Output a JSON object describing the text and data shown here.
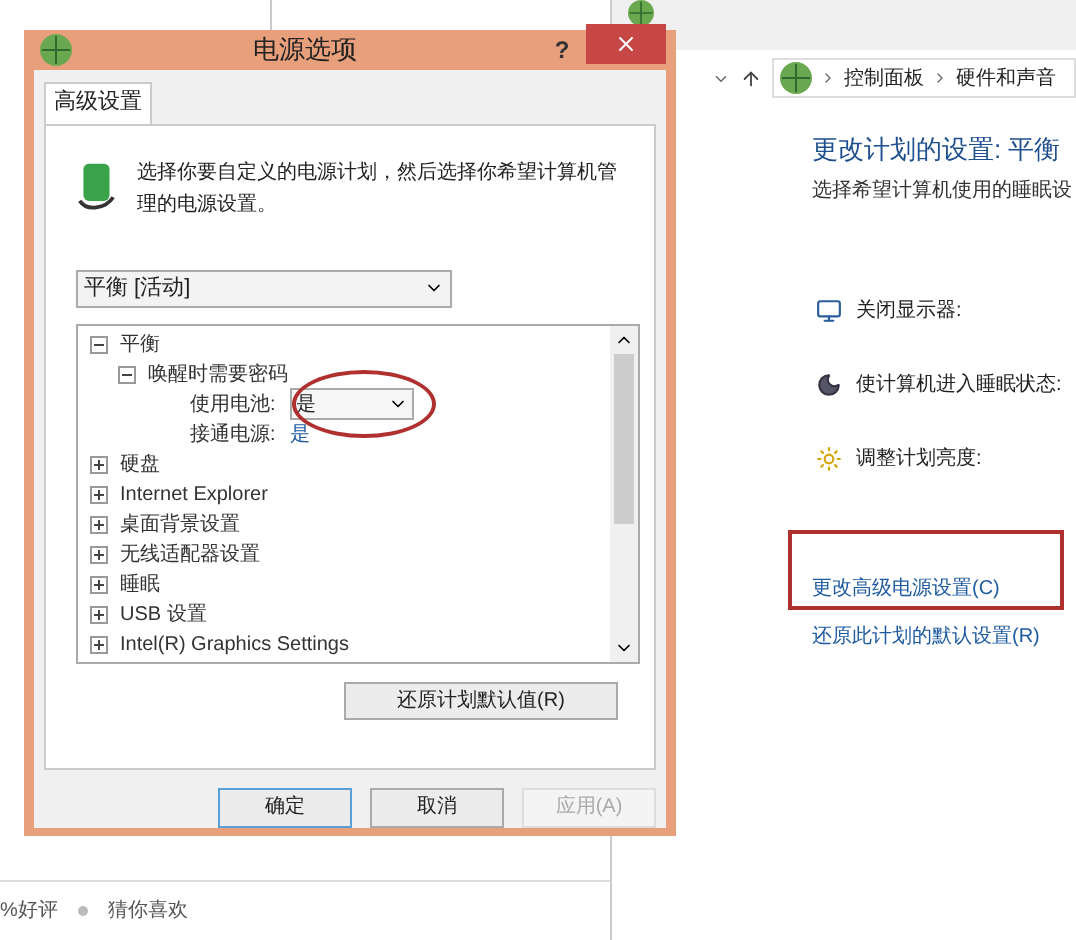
{
  "dialog": {
    "title": "电源选项",
    "help": "?",
    "tabs": [
      {
        "label": "高级设置",
        "selected": true
      }
    ],
    "description": "选择你要自定义的电源计划，然后选择你希望计算机管理的电源设置。",
    "plan_select": {
      "value": "平衡 [活动]"
    },
    "tree": [
      {
        "label": "平衡",
        "expanded": true,
        "children": [
          {
            "label": "唤醒时需要密码",
            "expanded": true,
            "children": [
              {
                "kind": "dropdown",
                "label": "使用电池:",
                "value": "是",
                "circled": true
              },
              {
                "kind": "text",
                "label": "接通电源:",
                "value": "是",
                "circled": false
              }
            ]
          }
        ]
      },
      {
        "label": "硬盘",
        "expanded": false
      },
      {
        "label": "Internet Explorer",
        "expanded": false
      },
      {
        "label": "桌面背景设置",
        "expanded": false
      },
      {
        "label": "无线适配器设置",
        "expanded": false
      },
      {
        "label": "睡眠",
        "expanded": false
      },
      {
        "label": "USB 设置",
        "expanded": false
      },
      {
        "label": "Intel(R) Graphics Settings",
        "expanded": false
      }
    ],
    "restore_button": "还原计划默认值(R)",
    "buttons": [
      {
        "label": "确定",
        "disabled": false,
        "default": true
      },
      {
        "label": "取消",
        "disabled": false,
        "default": false
      },
      {
        "label": "应用(A)",
        "disabled": true,
        "default": false
      }
    ]
  },
  "control_panel": {
    "breadcrumb": [
      "控制面板",
      "硬件和声音"
    ],
    "heading": "更改计划的设置: 平衡",
    "subtitle": "选择希望计算机使用的睡眠设",
    "settings": [
      {
        "kind": "display",
        "label": "关闭显示器:"
      },
      {
        "kind": "sleep",
        "label": "使计算机进入睡眠状态:"
      },
      {
        "kind": "brightness",
        "label": "调整计划亮度:"
      }
    ],
    "links": [
      {
        "label": "更改高级电源设置(C)",
        "highlighted": true
      },
      {
        "label": "还原此计划的默认设置(R)",
        "highlighted": false
      }
    ]
  },
  "footer": [
    "%好评",
    "猜你喜欢"
  ]
}
